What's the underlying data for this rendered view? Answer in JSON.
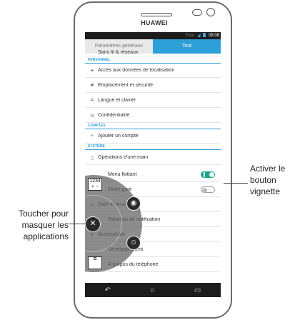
{
  "device": {
    "brand": "HUAWEI"
  },
  "statusbar": {
    "carrier": "Tone",
    "time": "08:08"
  },
  "tabs": [
    {
      "label": "Paramètres généraux"
    },
    {
      "label": "Tout"
    }
  ],
  "settings": {
    "partial_top": "Sans fil & réseaux",
    "section_personnel": "PERSONNEL",
    "section_comptes": "COMPTES",
    "section_systeme": "SYSTÈME",
    "items": [
      {
        "label": "Accès aux données de localisation",
        "icon": "location-target-icon"
      },
      {
        "label": "Emplacement et sécurité",
        "icon": "lock-icon"
      },
      {
        "label": "Langue et clavier",
        "icon": "language-icon"
      },
      {
        "label": "Confidentialité",
        "icon": "privacy-icon"
      },
      {
        "label": "Ajouter un compte",
        "icon": "plus-icon"
      },
      {
        "label": "Opérations d'une main",
        "icon": "one-hand-icon"
      },
      {
        "label": "Menu flottant",
        "toggle": "on"
      },
      {
        "label": "Mode gant",
        "toggle": "off"
      },
      {
        "label": "Date et heure",
        "icon": "clock-icon"
      },
      {
        "label": "Panneau de notification",
        "icon": "notification-icon"
      },
      {
        "label": "Accessibilité",
        "icon": "accessibility-icon"
      },
      {
        "label": "Développement",
        "icon": "developer-icon"
      },
      {
        "label": "À propos du téléphone",
        "icon": "info-icon"
      }
    ]
  },
  "floating_menu": {
    "calculator_label": "1234",
    "center_icon": "close-x-icon"
  },
  "callouts": {
    "right": "Activer le bouton vignette",
    "left": "Toucher pour masquer les applications"
  }
}
